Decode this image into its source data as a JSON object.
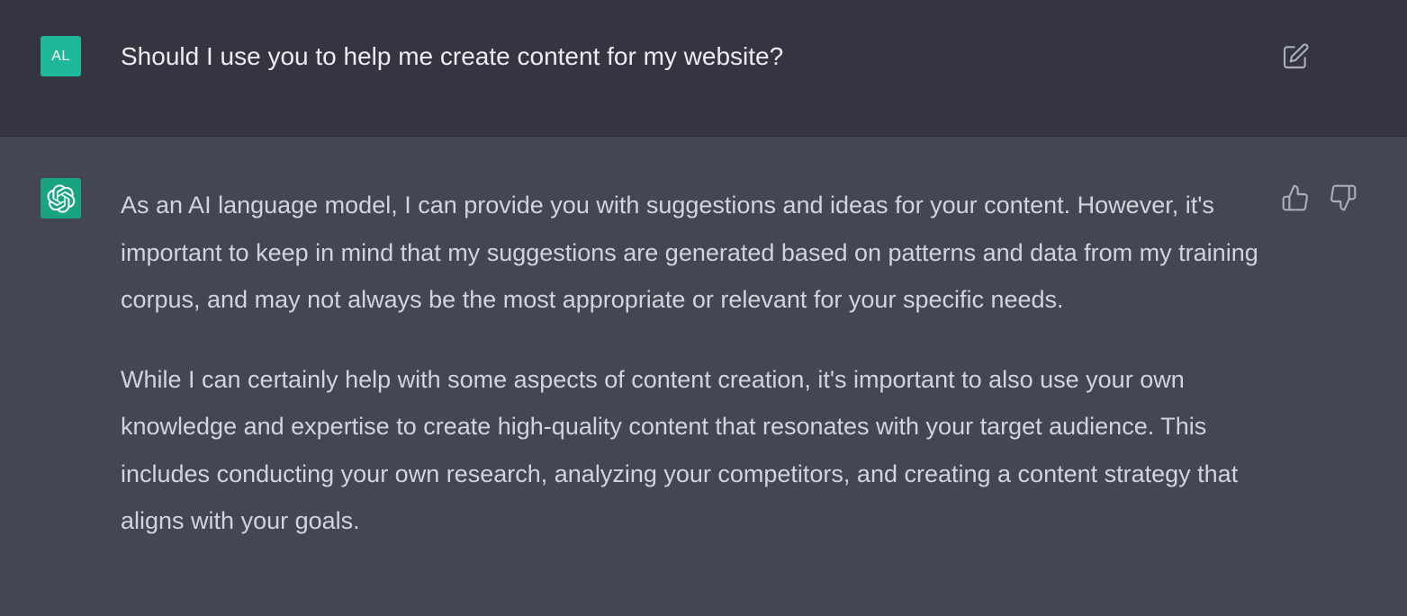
{
  "user_message": {
    "avatar_initials": "AL",
    "text": "Should I use you to help me create content for my website?"
  },
  "assistant_message": {
    "paragraphs": [
      "As an AI language model, I can provide you with suggestions and ideas for your content. However, it's important to keep in mind that my suggestions are generated based on patterns and data from my training corpus, and may not always be the most appropriate or relevant for your specific needs.",
      "While I can certainly help with some aspects of content creation, it's important to also use your own knowledge and expertise to create high-quality content that resonates with your target audience. This includes conducting your own research, analyzing your competitors, and creating a content strategy that aligns with your goals."
    ]
  },
  "icons": {
    "edit": "edit-icon",
    "thumbs_up": "thumbs-up-icon",
    "thumbs_down": "thumbs-down-icon",
    "assistant_logo": "openai-logo-icon"
  },
  "colors": {
    "user_bg": "#343541",
    "assistant_bg": "#444654",
    "user_avatar": "#1fb89a",
    "assistant_avatar": "#19a37f",
    "text_primary": "#ececf1",
    "text_secondary": "#d1d5db",
    "icon": "#acacbe"
  }
}
